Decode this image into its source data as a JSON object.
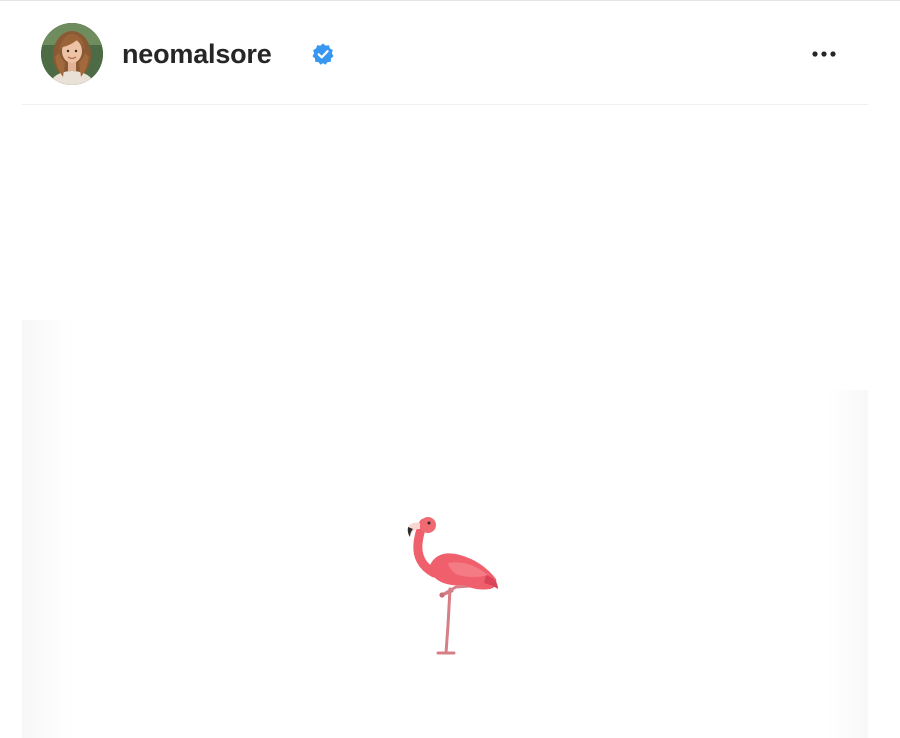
{
  "post": {
    "author": {
      "username": "neomalsore",
      "verified": true,
      "avatar_alt": "profile photo"
    },
    "more_icon": "more-horizontal-icon",
    "verified_icon": "verified-badge-icon",
    "media": {
      "emoji": "flamingo",
      "background": "#ffffff"
    }
  },
  "colors": {
    "verified_blue": "#3897f0",
    "text": "#262626",
    "flamingo_pink": "#f0606a"
  }
}
